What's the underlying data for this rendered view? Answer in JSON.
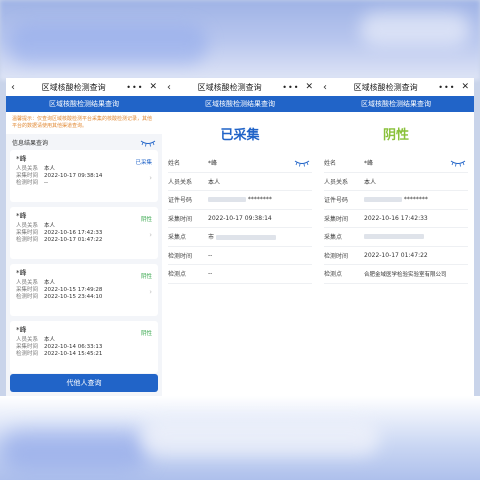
{
  "panel1": {
    "nav": {
      "back": "‹",
      "title": "区域核酸检测查询",
      "more": "•••",
      "close": "✕"
    },
    "header": "区域核酸检测结果查询",
    "notice": "温馨提示：仅查询区域核酸检测平台采集的核酸检测记录，其他平台的数据请使用其他渠道查询。",
    "section_title": "信息结果查询",
    "labels": {
      "relation": "人员关系",
      "collect_time": "采集时间",
      "test_time": "检测时间"
    },
    "records": [
      {
        "name": "*峰",
        "status": "已采集",
        "relation": "本人",
        "collect_time": "2022-10-17 09:38:14",
        "test_time": "--"
      },
      {
        "name": "*峰",
        "status": "阴性",
        "relation": "本人",
        "collect_time": "2022-10-16 17:42:33",
        "test_time": "2022-10-17 01:47:22"
      },
      {
        "name": "*峰",
        "status": "阴性",
        "relation": "本人",
        "collect_time": "2022-10-15 17:49:28",
        "test_time": "2022-10-15 23:44:10"
      },
      {
        "name": "*峰",
        "status": "阴性",
        "relation": "本人",
        "collect_time": "2022-10-14 06:33:13",
        "test_time": "2022-10-14 15:45:21"
      }
    ],
    "button": "代他人查询"
  },
  "panel2": {
    "nav": {
      "back": "‹",
      "title": "区域核酸检测查询",
      "more": "•••",
      "close": "✕"
    },
    "header": "区域核酸检测结果查询",
    "status": "已采集",
    "rows": [
      {
        "label": "姓名",
        "value": "*峰"
      },
      {
        "label": "人员关系",
        "value": "本人"
      },
      {
        "label": "证件号码",
        "value": "********"
      },
      {
        "label": "采集时间",
        "value": "2022-10-17 09:38:14"
      },
      {
        "label": "采集点",
        "value": "市"
      },
      {
        "label": "检测时间",
        "value": "--"
      },
      {
        "label": "检测点",
        "value": "--"
      }
    ]
  },
  "panel3": {
    "nav": {
      "back": "‹",
      "title": "区域核酸检测查询",
      "more": "•••",
      "close": "✕"
    },
    "header": "区域核酸检测结果查询",
    "status": "阴性",
    "rows": [
      {
        "label": "姓名",
        "value": "*峰"
      },
      {
        "label": "人员关系",
        "value": "本人"
      },
      {
        "label": "证件号码",
        "value": "********"
      },
      {
        "label": "采集时间",
        "value": "2022-10-16 17:42:33"
      },
      {
        "label": "采集点",
        "value": ""
      },
      {
        "label": "检测时间",
        "value": "2022-10-17 01:47:22"
      },
      {
        "label": "检测点",
        "value": "合肥金域医学检验实验室有限公司"
      }
    ]
  },
  "colors": {
    "primary": "#2164c8",
    "collected": "#2164c8",
    "negative": "#35a64a",
    "negative_big": "#8ac13b",
    "notice": "#e28a36"
  },
  "icons": {
    "eye": "eye-closed-icon"
  }
}
